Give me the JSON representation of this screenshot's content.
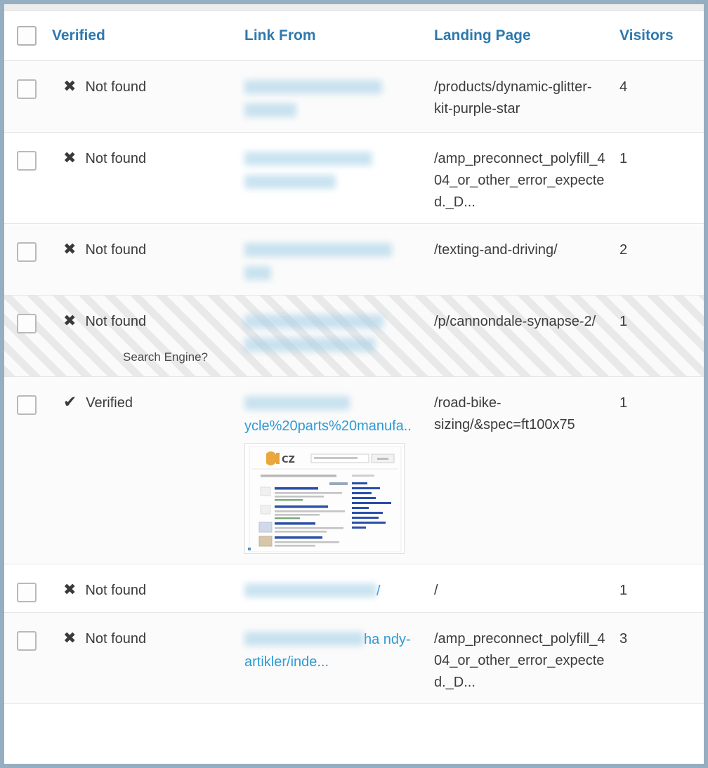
{
  "table": {
    "columns": [
      {
        "key": "select",
        "label": ""
      },
      {
        "key": "verified",
        "label": "Verified"
      },
      {
        "key": "link_from",
        "label": "Link From"
      },
      {
        "key": "landing_page",
        "label": "Landing Page"
      },
      {
        "key": "visitors",
        "label": "Visitors"
      }
    ],
    "icons": {
      "not_found": "✖",
      "verified": "✔",
      "checkbox": "checkbox-unchecked"
    },
    "rows": [
      {
        "verified_status": "Not found",
        "verified_icon": "not-found-icon",
        "note": "",
        "link_from_visible": "",
        "link_from_redacted": true,
        "link_from_lines": 2,
        "has_thumbnail": false,
        "landing_page": "/products/dynamic-glitter-kit-purple-star",
        "visitors": "4",
        "striped": false
      },
      {
        "verified_status": "Not found",
        "verified_icon": "not-found-icon",
        "note": "",
        "link_from_visible": "",
        "link_from_redacted": true,
        "link_from_lines": 2,
        "has_thumbnail": false,
        "landing_page": "/amp_preconnect_polyfill_404_or_other_error_expected._D...",
        "visitors": "1",
        "striped": false
      },
      {
        "verified_status": "Not found",
        "verified_icon": "not-found-icon",
        "note": "",
        "link_from_visible": "",
        "link_from_redacted": true,
        "link_from_lines": 2,
        "has_thumbnail": false,
        "landing_page": "/texting-and-driving/",
        "visitors": "2",
        "striped": false
      },
      {
        "verified_status": "Not found",
        "verified_icon": "not-found-icon",
        "note": "Search Engine?",
        "link_from_visible": "",
        "link_from_redacted": true,
        "link_from_lines": 2,
        "has_thumbnail": false,
        "landing_page": "/p/cannondale-synapse-2/",
        "visitors": "1",
        "striped": true
      },
      {
        "verified_status": "Verified",
        "verified_icon": "verified-icon",
        "note": "",
        "link_from_visible": "ycle%20parts%20manufa..",
        "link_from_redacted": true,
        "link_from_lines": 2,
        "has_thumbnail": true,
        "landing_page": "/road-bike-sizing/&spec=ft100x75",
        "visitors": "1",
        "striped": false
      },
      {
        "verified_status": "Not found",
        "verified_icon": "not-found-icon",
        "note": "",
        "link_from_visible": "/",
        "link_from_redacted": true,
        "link_from_lines": 1,
        "has_thumbnail": false,
        "landing_page": "/",
        "visitors": "1",
        "striped": false
      },
      {
        "verified_status": "Not found",
        "verified_icon": "not-found-icon",
        "note": "",
        "link_from_visible": "ha ndy-artikler/inde...",
        "link_from_redacted": true,
        "link_from_lines": 2,
        "has_thumbnail": false,
        "landing_page": "/amp_preconnect_polyfill_404_or_other_error_expected._D...",
        "visitors": "3",
        "striped": false
      }
    ]
  },
  "thumbnail": {
    "alt": "search-results-page-preview",
    "logo_text": "CZ",
    "logo_color": "#e8a33d",
    "link_color": "#2a4fa8"
  },
  "colors": {
    "header_text": "#2e79ae",
    "link": "#2f9ad4",
    "body_text": "#3c3c3c",
    "frame_border": "#96aec0",
    "row_border": "#e6e6e6",
    "stripe": "#e9e9e9"
  }
}
